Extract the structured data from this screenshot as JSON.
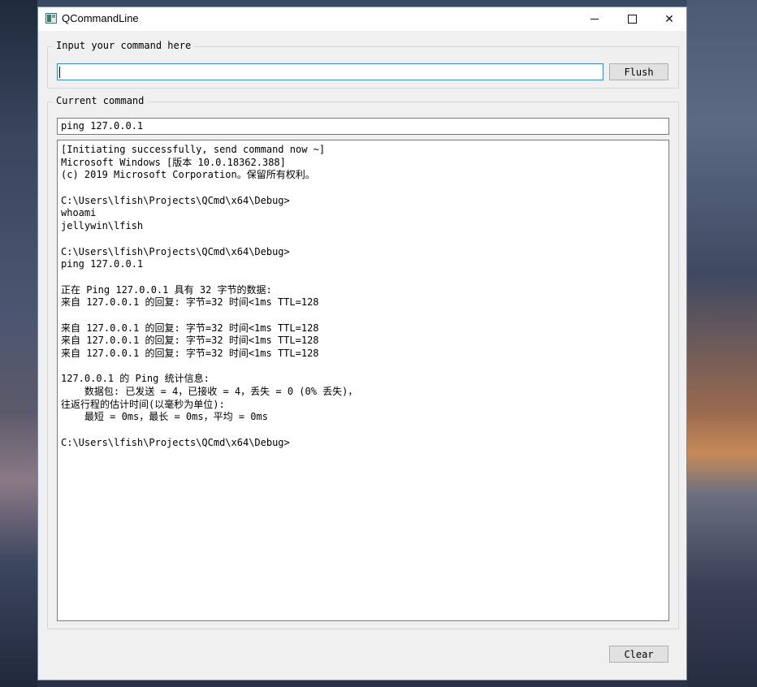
{
  "window": {
    "title": "QCommandLine",
    "controls": {
      "minimize": "minimize",
      "maximize": "maximize",
      "close": "✕"
    }
  },
  "input_group": {
    "title": "Input your command here",
    "input_value": "",
    "flush_label": "Flush"
  },
  "current_group": {
    "title": "Current command",
    "command": "ping 127.0.0.1",
    "console_lines": [
      "[Initiating successfully, send command now ~]",
      "Microsoft Windows [版本 10.0.18362.388]",
      "(c) 2019 Microsoft Corporation。保留所有权利。",
      "",
      "C:\\Users\\lfish\\Projects\\QCmd\\x64\\Debug>",
      "whoami",
      "jellywin\\lfish",
      "",
      "C:\\Users\\lfish\\Projects\\QCmd\\x64\\Debug>",
      "ping 127.0.0.1",
      "",
      "正在 Ping 127.0.0.1 具有 32 字节的数据:",
      "来自 127.0.0.1 的回复: 字节=32 时间<1ms TTL=128",
      "",
      "来自 127.0.0.1 的回复: 字节=32 时间<1ms TTL=128",
      "来自 127.0.0.1 的回复: 字节=32 时间<1ms TTL=128",
      "来自 127.0.0.1 的回复: 字节=32 时间<1ms TTL=128",
      "",
      "127.0.0.1 的 Ping 统计信息:",
      "    数据包: 已发送 = 4，已接收 = 4，丢失 = 0 (0% 丢失)，",
      "往返行程的估计时间(以毫秒为单位):",
      "    最短 = 0ms，最长 = 0ms，平均 = 0ms",
      "",
      "C:\\Users\\lfish\\Projects\\QCmd\\x64\\Debug>"
    ]
  },
  "footer": {
    "clear_label": "Clear"
  },
  "icons": {
    "app": "app-icon",
    "minimize": "minimize-icon",
    "maximize": "maximize-icon",
    "close": "close-icon"
  }
}
